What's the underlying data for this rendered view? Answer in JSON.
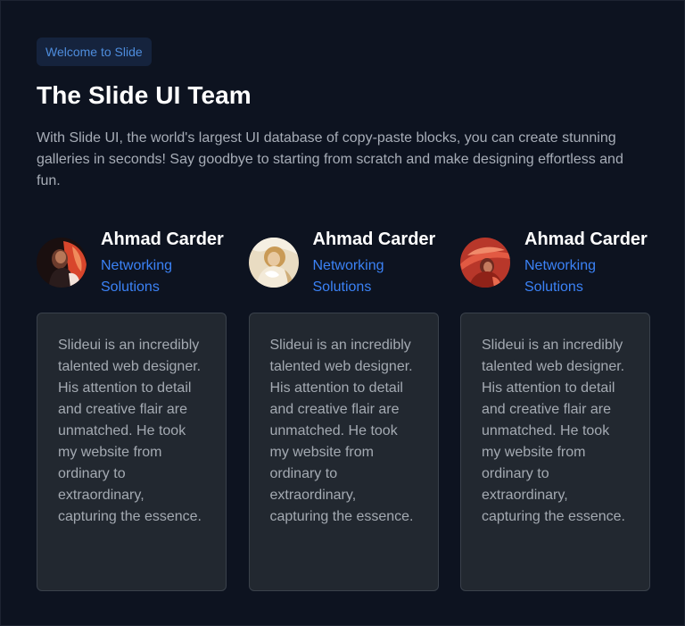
{
  "badge": "Welcome to Slide",
  "title": "The Slide UI Team",
  "intro": "With Slide UI, the world's largest UI database of copy-paste blocks, you can create stunning galleries in seconds! Say goodbye to starting from scratch and make designing effortless and fun.",
  "team": [
    {
      "name": "Ahmad Carder",
      "role": "Networking Solutions",
      "avatar_icon": "portrait-red-avatar",
      "testimonial": "Slideui is an incredibly talented web designer. His attention to detail and creative flair are unmatched. He took my website from ordinary to extraordinary, capturing the essence."
    },
    {
      "name": "Ahmad Carder",
      "role": "Networking Solutions",
      "avatar_icon": "portrait-light-avatar",
      "testimonial": "Slideui is an incredibly talented web designer. His attention to detail and creative flair are unmatched. He took my website from ordinary to extraordinary, capturing the essence."
    },
    {
      "name": "Ahmad Carder",
      "role": "Networking Solutions",
      "avatar_icon": "portrait-hat-avatar",
      "testimonial": "Slideui is an incredibly talented web designer. His attention to detail and creative flair are unmatched. He took my website from ordinary to extraordinary, capturing the essence."
    }
  ],
  "colors": {
    "background": "#0d1320",
    "accent": "#3b82f6",
    "badge_bg": "#15233d",
    "card_bg": "#222830",
    "card_border": "#3a414b"
  }
}
